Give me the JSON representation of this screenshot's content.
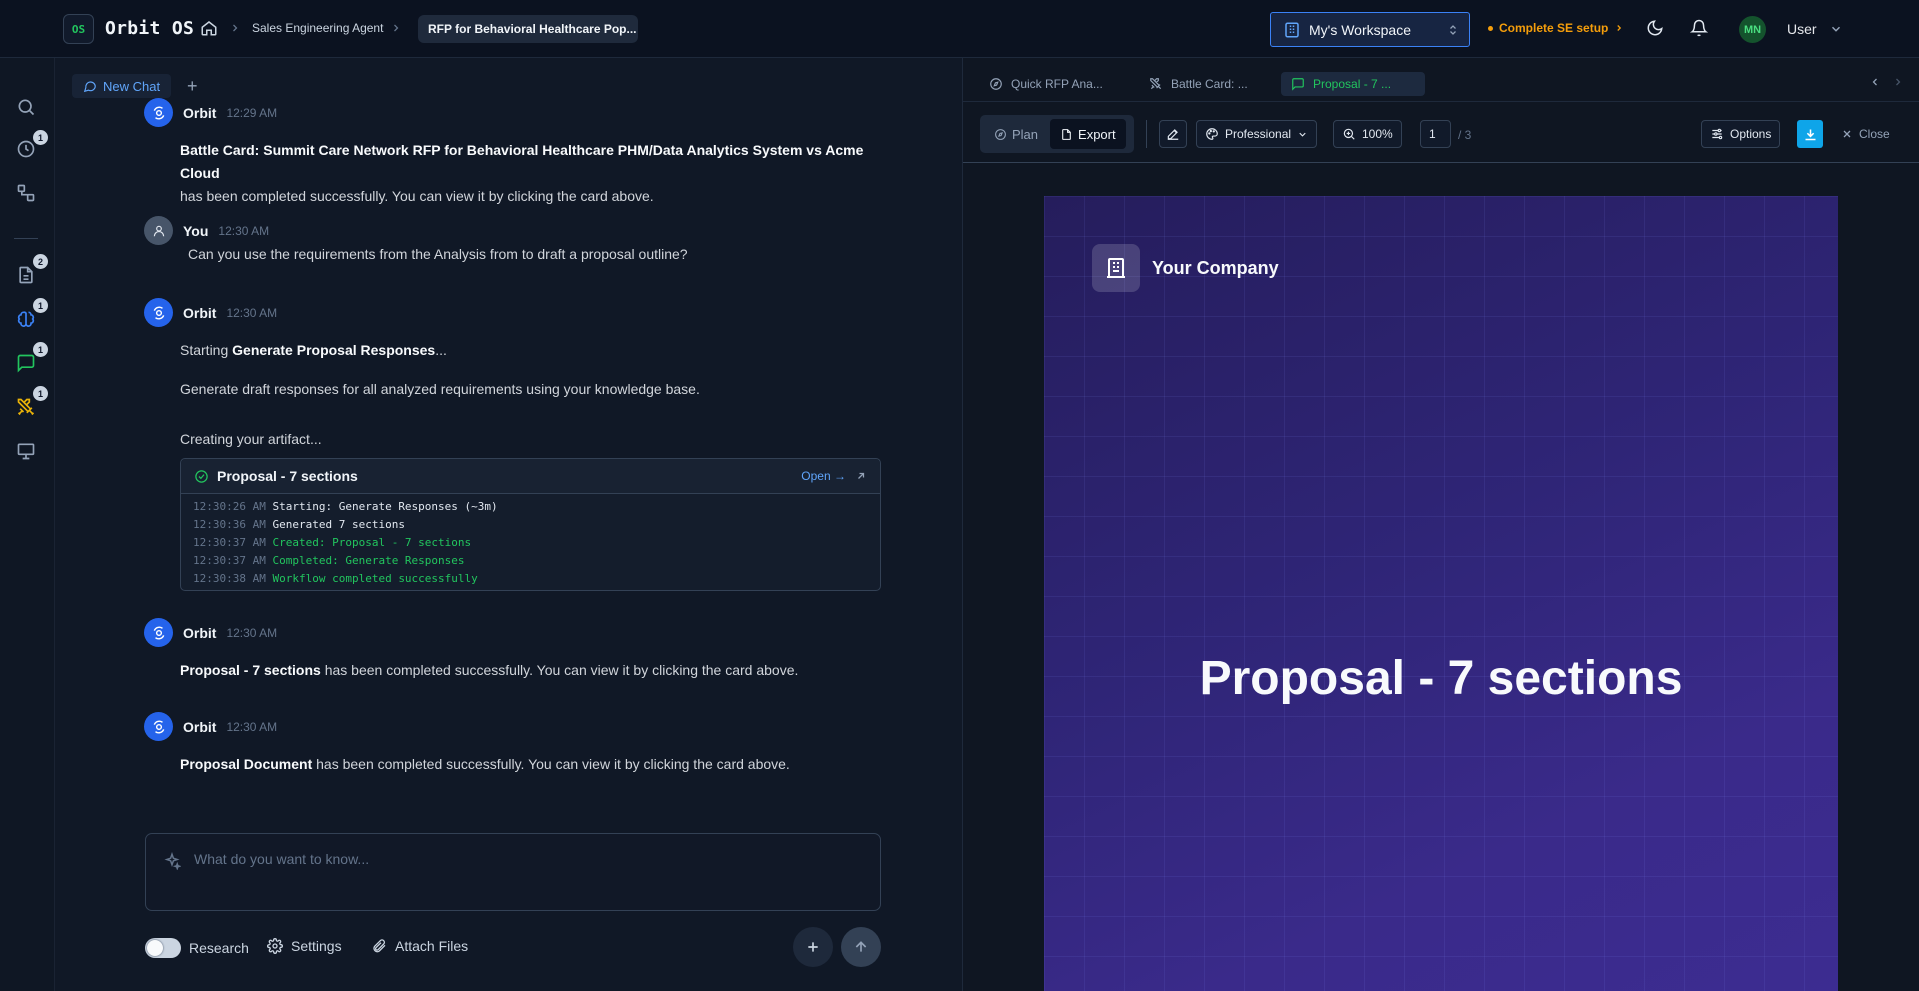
{
  "app": {
    "logo_badge": "OS",
    "title": "Orbit OS"
  },
  "breadcrumb": {
    "agent": "Sales Engineering Agent",
    "current": "RFP for Behavioral Healthcare Pop..."
  },
  "workspace": {
    "label": "My's Workspace"
  },
  "setup": {
    "label": "Complete SE setup"
  },
  "user": {
    "initials": "MN",
    "name": "User"
  },
  "rail": {
    "badges": {
      "history": "1",
      "docs": "2",
      "brain": "1",
      "chat": "1",
      "battle": "1"
    }
  },
  "chat": {
    "tab_label": "New Chat",
    "messages": [
      {
        "name": "Orbit",
        "time": "12:29 AM",
        "bold": "Battle Card: Summit Care Network RFP for Behavioral Healthcare PHM/Data Analytics System vs Acme Cloud",
        "text": "has been completed successfully. You can view it by clicking the card above."
      },
      {
        "name": "You",
        "time": "12:30 AM",
        "text": "Can you use the requirements from the Analysis from to draft a proposal outline?"
      },
      {
        "name": "Orbit",
        "time": "12:30 AM",
        "starting_prefix": "Starting ",
        "starting_bold": "Generate Proposal Responses",
        "starting_suffix": "...",
        "desc": "Generate draft responses for all analyzed requirements using your knowledge base.",
        "creating": "Creating your artifact..."
      },
      {
        "name": "Orbit",
        "time": "12:30 AM",
        "bold": "Proposal - 7 sections",
        "text": "has been completed successfully. You can view it by clicking the card above."
      },
      {
        "name": "Orbit",
        "time": "12:30 AM",
        "bold": "Proposal Document",
        "text": "has been completed successfully. You can view it by clicking the card above."
      }
    ],
    "artifact": {
      "title": "Proposal - 7 sections",
      "open_label": "Open →",
      "log": [
        {
          "time": "12:30:26 AM",
          "msg": "Starting: Generate Responses (~3m)"
        },
        {
          "time": "12:30:36 AM",
          "msg": "Generated 7 sections"
        },
        {
          "time": "12:30:37 AM",
          "msg": "Created: Proposal - 7 sections"
        },
        {
          "time": "12:30:37 AM",
          "msg": "Completed: Generate Responses"
        },
        {
          "time": "12:30:38 AM",
          "msg": "Workflow completed successfully"
        }
      ]
    },
    "composer": {
      "placeholder": "What do you want to know..."
    },
    "bottom": {
      "research": "Research",
      "settings": "Settings",
      "attach": "Attach Files"
    }
  },
  "panel": {
    "tabs": [
      {
        "label": "Quick RFP Ana..."
      },
      {
        "label": "Battle Card: ..."
      },
      {
        "label": "Proposal - 7 ..."
      }
    ],
    "toolbar": {
      "plan": "Plan",
      "export": "Export",
      "theme": "Professional",
      "zoom": "100%",
      "page": "1",
      "page_total": "/ 3",
      "options": "Options",
      "close": "Close"
    },
    "document": {
      "company": "Your Company",
      "title": "Proposal - 7 sections"
    }
  },
  "colors": {
    "accent": "#3b82f6",
    "success": "#22c55e",
    "warning": "#f59e0b",
    "doc_bg": "#2f2577"
  }
}
